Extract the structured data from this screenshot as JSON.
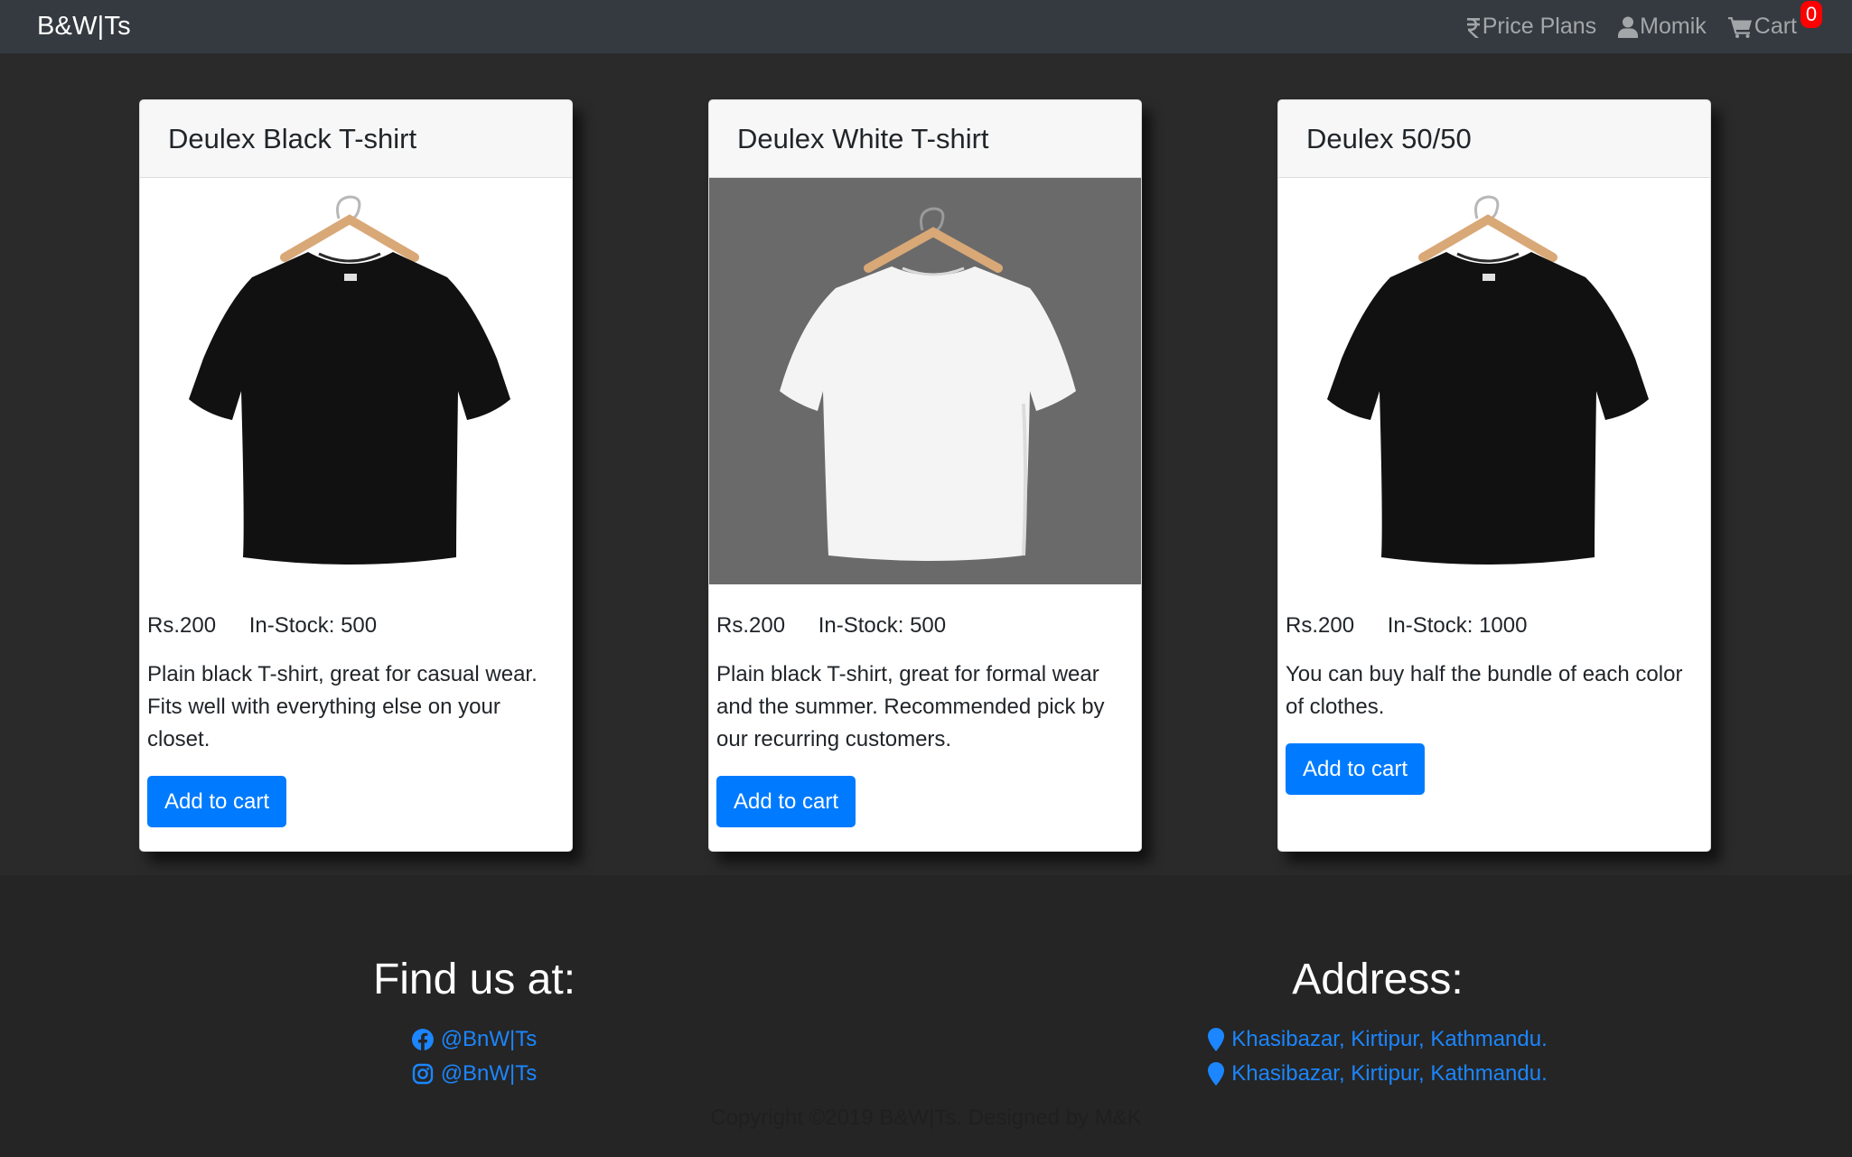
{
  "navbar": {
    "brand": "B&W|Ts",
    "price_plans": "Price Plans",
    "user": "Momik",
    "cart": "Cart",
    "cart_count": "0"
  },
  "products": [
    {
      "title": "Deulex Black T-shirt",
      "price": "Rs.200",
      "stock": "In-Stock: 500",
      "description": "Plain black T-shirt, great for casual wear. Fits well with everything else on your closet.",
      "button": "Add to cart",
      "shirt_color": "#111111"
    },
    {
      "title": "Deulex White T-shirt",
      "price": "Rs.200",
      "stock": "In-Stock: 500",
      "description": "Plain black T-shirt, great for formal wear and the summer. Recommended pick by our recurring customers.",
      "button": "Add to cart",
      "shirt_color": "#f4f4f4"
    },
    {
      "title": "Deulex 50/50",
      "price": "Rs.200",
      "stock": "In-Stock: 1000",
      "description": "You can buy half the bundle of each color of clothes.",
      "button": "Add to cart",
      "shirt_color": "#111111"
    }
  ],
  "footer": {
    "find_title": "Find us at:",
    "facebook": "@BnW|Ts",
    "instagram": "@BnW|Ts",
    "address_title": "Address:",
    "address_1": "Khasibazar, Kirtipur, Kathmandu.",
    "address_2": "Khasibazar, Kirtipur, Kathmandu.",
    "copyright": "Copyright ©2019 B&W|Ts. Designed by M&K"
  },
  "colors": {
    "navbar_bg": "#343a40",
    "page_bg": "#2a2a2a",
    "primary": "#007bff",
    "badge": "#ff0000"
  },
  "icons": [
    "rupee-icon",
    "user-icon",
    "cart-icon",
    "facebook-icon",
    "instagram-icon",
    "map-pin-icon"
  ]
}
